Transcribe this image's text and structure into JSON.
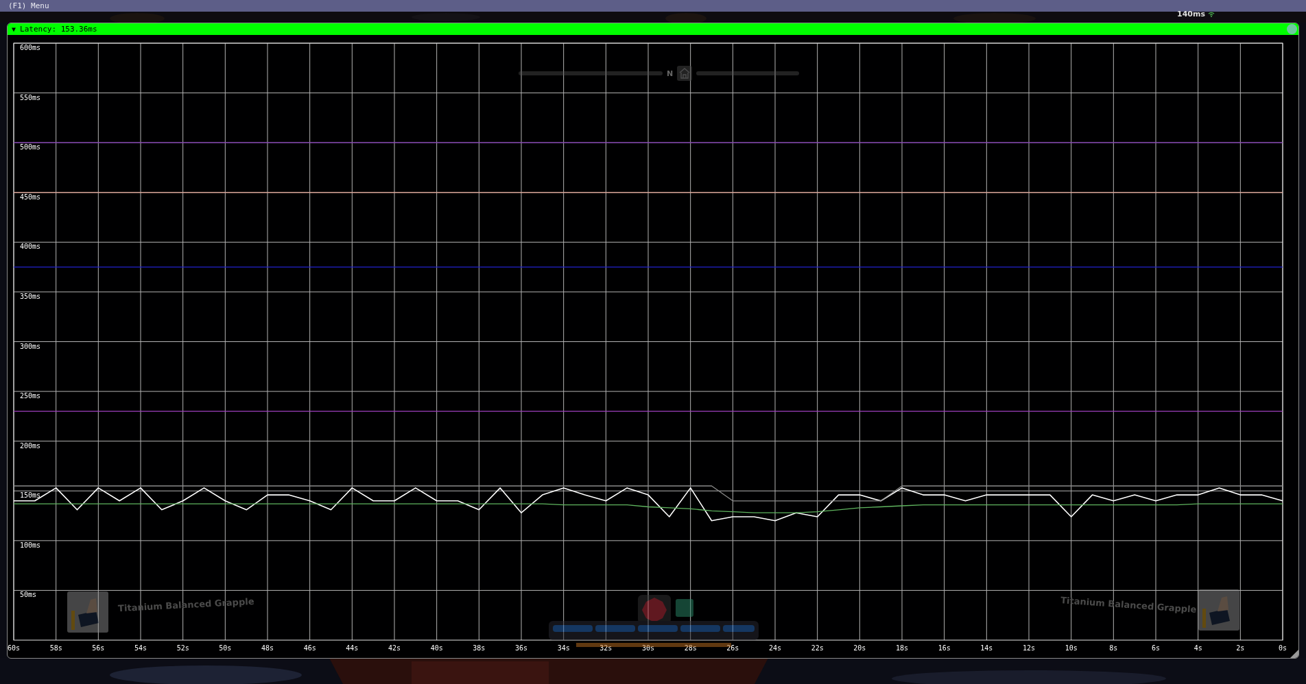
{
  "menu_bar": {
    "label": "(F1) Menu"
  },
  "hud": {
    "ping": "140ms",
    "compass": "N",
    "item_labels": [
      "Titanium Balanced Grapple",
      "Titanium Balanced Grapple"
    ]
  },
  "window": {
    "collapse_glyph": "▼",
    "title": "Latency: 153.36ms",
    "chart_data": {
      "type": "line",
      "x": [
        60,
        59,
        58,
        57,
        56,
        55,
        54,
        53,
        52,
        51,
        50,
        49,
        48,
        47,
        46,
        45,
        44,
        43,
        42,
        41,
        40,
        39,
        38,
        37,
        36,
        35,
        34,
        33,
        32,
        31,
        30,
        29,
        28,
        27,
        26,
        25,
        24,
        23,
        22,
        21,
        20,
        19,
        18,
        17,
        16,
        15,
        14,
        13,
        12,
        11,
        10,
        9,
        8,
        7,
        6,
        5,
        4,
        3,
        2,
        1,
        0
      ],
      "grid": true,
      "series": [
        {
          "color": "#7b2fb0",
          "values": [
            500,
            500,
            500,
            500,
            500,
            500,
            500,
            500,
            500,
            500,
            500,
            500,
            500,
            500,
            500,
            500,
            500,
            500,
            500,
            500,
            500,
            500,
            500,
            500,
            500,
            500,
            500,
            500,
            500,
            500,
            500,
            500,
            500,
            500,
            500,
            500,
            500,
            500,
            500,
            500,
            500,
            500,
            500,
            500,
            500,
            500,
            500,
            500,
            500,
            500,
            500,
            500,
            500,
            500,
            500,
            500,
            500,
            500,
            500,
            500,
            500
          ]
        },
        {
          "color": "#e0a090",
          "values": [
            450,
            450,
            450,
            450,
            450,
            450,
            450,
            450,
            450,
            450,
            450,
            450,
            450,
            450,
            450,
            450,
            450,
            450,
            450,
            450,
            450,
            450,
            450,
            450,
            450,
            450,
            450,
            450,
            450,
            450,
            450,
            450,
            450,
            450,
            450,
            450,
            450,
            450,
            450,
            450,
            450,
            450,
            450,
            450,
            450,
            450,
            450,
            450,
            450,
            450,
            450,
            450,
            450,
            450,
            450,
            450,
            450,
            450,
            450,
            450,
            450
          ]
        },
        {
          "color": "#2222cc",
          "values": [
            375,
            375,
            375,
            375,
            375,
            375,
            375,
            375,
            375,
            375,
            375,
            375,
            375,
            375,
            375,
            375,
            375,
            375,
            375,
            375,
            375,
            375,
            375,
            375,
            375,
            375,
            375,
            375,
            375,
            375,
            375,
            375,
            375,
            375,
            375,
            375,
            375,
            375,
            375,
            375,
            375,
            375,
            375,
            375,
            375,
            375,
            375,
            375,
            375,
            375,
            375,
            375,
            375,
            375,
            375,
            375,
            375,
            375,
            375,
            375,
            375
          ]
        },
        {
          "color": "#a040c0",
          "values": [
            230,
            230,
            230,
            230,
            230,
            230,
            230,
            230,
            230,
            230,
            230,
            230,
            230,
            230,
            230,
            230,
            230,
            230,
            230,
            230,
            230,
            230,
            230,
            230,
            230,
            230,
            230,
            230,
            230,
            230,
            230,
            230,
            230,
            230,
            230,
            230,
            230,
            230,
            230,
            230,
            230,
            230,
            230,
            230,
            230,
            230,
            230,
            230,
            230,
            230,
            230,
            230,
            230,
            230,
            230,
            230,
            230,
            230,
            230,
            230,
            230
          ]
        },
        {
          "color": "#ffffff",
          "values": [
            140,
            140,
            153,
            131,
            153,
            140,
            153,
            131,
            140,
            153,
            140,
            131,
            146,
            146,
            140,
            131,
            153,
            140,
            140,
            153,
            140,
            140,
            131,
            153,
            128,
            146,
            153,
            146,
            140,
            153,
            146,
            124,
            153,
            120,
            124,
            124,
            120,
            128,
            124,
            146,
            146,
            140,
            153,
            146,
            146,
            140,
            146,
            146,
            146,
            146,
            124,
            146,
            140,
            146,
            140,
            146,
            146,
            153,
            146,
            146,
            140
          ]
        },
        {
          "color": "#5fb55f",
          "values": [
            137,
            137,
            137,
            137,
            137,
            137,
            137,
            137,
            137,
            137,
            137,
            137,
            137,
            137,
            137,
            137,
            137,
            137,
            137,
            137,
            137,
            137,
            137,
            137,
            137,
            137,
            136,
            136,
            136,
            136,
            134,
            133,
            132,
            130,
            129,
            128,
            128,
            128,
            129,
            131,
            133,
            134,
            135,
            136,
            136,
            136,
            136,
            136,
            136,
            136,
            136,
            136,
            136,
            136,
            136,
            136,
            137,
            137,
            137,
            137,
            137
          ]
        },
        {
          "color": "#8a8a8a",
          "values": [
            155,
            155,
            155,
            155,
            155,
            155,
            155,
            155,
            155,
            155,
            155,
            155,
            155,
            155,
            155,
            155,
            155,
            155,
            155,
            155,
            155,
            155,
            155,
            155,
            155,
            155,
            155,
            155,
            155,
            155,
            155,
            155,
            155,
            155,
            140,
            140,
            140,
            140,
            140,
            140,
            140,
            140,
            155,
            155,
            155,
            155,
            155,
            155,
            155,
            155,
            155,
            155,
            155,
            155,
            155,
            155,
            155,
            155,
            155,
            155,
            155
          ]
        }
      ],
      "xlim": [
        60,
        0
      ],
      "ylim": [
        0,
        600
      ],
      "xticks": [
        {
          "value": 60,
          "label": "60s"
        },
        {
          "value": 58,
          "label": "58s"
        },
        {
          "value": 56,
          "label": "56s"
        },
        {
          "value": 54,
          "label": "54s"
        },
        {
          "value": 52,
          "label": "52s"
        },
        {
          "value": 50,
          "label": "50s"
        },
        {
          "value": 48,
          "label": "48s"
        },
        {
          "value": 46,
          "label": "46s"
        },
        {
          "value": 44,
          "label": "44s"
        },
        {
          "value": 42,
          "label": "42s"
        },
        {
          "value": 40,
          "label": "40s"
        },
        {
          "value": 38,
          "label": "38s"
        },
        {
          "value": 36,
          "label": "36s"
        },
        {
          "value": 34,
          "label": "34s"
        },
        {
          "value": 32,
          "label": "32s"
        },
        {
          "value": 30,
          "label": "30s"
        },
        {
          "value": 28,
          "label": "28s"
        },
        {
          "value": 26,
          "label": "26s"
        },
        {
          "value": 24,
          "label": "24s"
        },
        {
          "value": 22,
          "label": "22s"
        },
        {
          "value": 20,
          "label": "20s"
        },
        {
          "value": 18,
          "label": "18s"
        },
        {
          "value": 16,
          "label": "16s"
        },
        {
          "value": 14,
          "label": "14s"
        },
        {
          "value": 12,
          "label": "12s"
        },
        {
          "value": 10,
          "label": "10s"
        },
        {
          "value": 8,
          "label": "8s"
        },
        {
          "value": 6,
          "label": "6s"
        },
        {
          "value": 4,
          "label": "4s"
        },
        {
          "value": 2,
          "label": "2s"
        },
        {
          "value": 0,
          "label": "0s"
        }
      ],
      "yticks": [
        {
          "value": 600,
          "label": "600ms"
        },
        {
          "value": 550,
          "label": "550ms"
        },
        {
          "value": 500,
          "label": "500ms"
        },
        {
          "value": 450,
          "label": "450ms"
        },
        {
          "value": 400,
          "label": "400ms"
        },
        {
          "value": 350,
          "label": "350ms"
        },
        {
          "value": 300,
          "label": "300ms"
        },
        {
          "value": 250,
          "label": "250ms"
        },
        {
          "value": 200,
          "label": "200ms"
        },
        {
          "value": 150,
          "label": "150ms"
        },
        {
          "value": 100,
          "label": "100ms"
        },
        {
          "value": 50,
          "label": "50ms"
        }
      ]
    }
  }
}
